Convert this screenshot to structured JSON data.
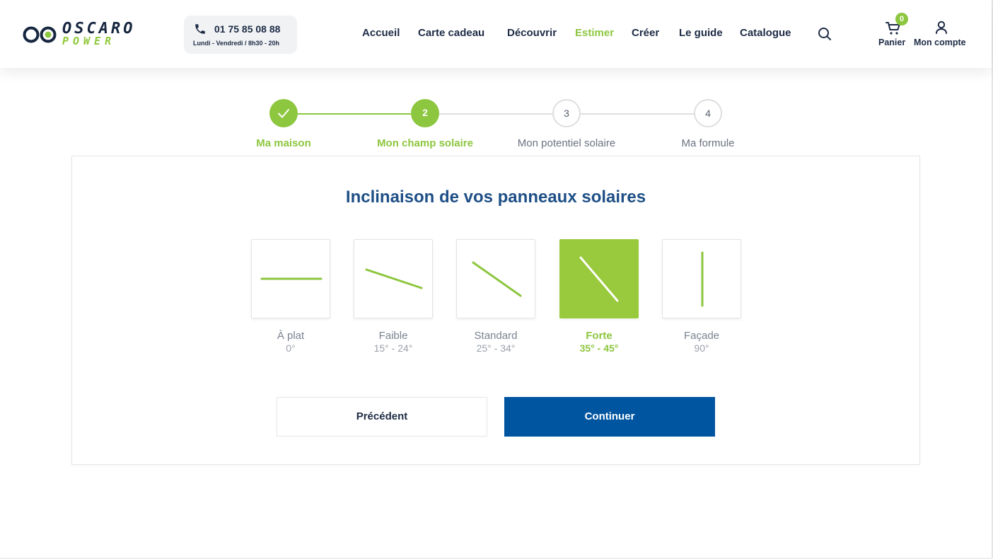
{
  "brand": {
    "line1": "OSCARO",
    "line2": "POWER",
    "accent_color": "#8dc63f",
    "dark_color": "#16263f"
  },
  "contact": {
    "phone": "01 75 85 08 88",
    "hours": "Lundi - Vendredi / 8h30 - 20h",
    "icon": "phone-icon"
  },
  "nav": {
    "items": [
      {
        "label": "Accueil",
        "active": false
      },
      {
        "label": "Carte cadeau",
        "active": false
      },
      {
        "label": "Découvrir",
        "active": false
      },
      {
        "label": "Estimer",
        "active": true
      },
      {
        "label": "Créer",
        "active": false
      },
      {
        "label": "Le guide",
        "active": false
      },
      {
        "label": "Catalogue",
        "active": false
      }
    ],
    "search_icon": "search-icon",
    "cart": {
      "label": "Panier",
      "count": "0",
      "icon": "cart-icon"
    },
    "account": {
      "label": "Mon compte",
      "icon": "user-icon"
    }
  },
  "stepper": {
    "steps": [
      {
        "number": "",
        "label": "Ma maison",
        "state": "done",
        "icon": "check-icon"
      },
      {
        "number": "2",
        "label": "Mon champ solaire",
        "state": "current"
      },
      {
        "number": "3",
        "label": "Mon potentiel solaire",
        "state": "todo"
      },
      {
        "number": "4",
        "label": "Ma formule",
        "state": "todo"
      }
    ]
  },
  "form": {
    "title": "Inclinaison de vos panneaux solaires",
    "options": [
      {
        "label": "À plat",
        "range": "0°",
        "selected": false,
        "angle_deg": 0
      },
      {
        "label": "Faible",
        "range": "15° - 24°",
        "selected": false,
        "angle_deg": 20
      },
      {
        "label": "Standard",
        "range": "25° - 34°",
        "selected": false,
        "angle_deg": 33
      },
      {
        "label": "Forte",
        "range": "35° - 45°",
        "selected": true,
        "angle_deg": 52
      },
      {
        "label": "Façade",
        "range": "90°",
        "selected": false,
        "angle_deg": 90
      }
    ],
    "prev_label": "Précédent",
    "next_label": "Continuer",
    "next_color": "#0055a0"
  }
}
